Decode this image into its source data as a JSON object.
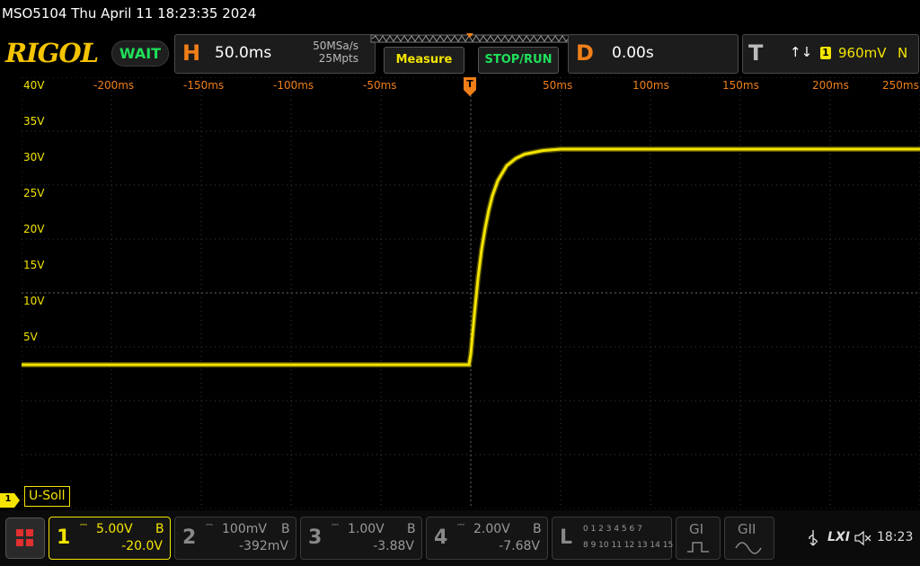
{
  "status": {
    "text": "MSO5104  Thu April 11 18:23:35 2024"
  },
  "header": {
    "logo": "RIGOL",
    "run_state": "WAIT",
    "horizontal": {
      "letter": "H",
      "timebase": "50.0ms",
      "sample_rate": "50MSa/s",
      "memory_depth": "25Mpts"
    },
    "measure_label": "Measure",
    "stop_run_label": "STOP/RUN",
    "delay": {
      "letter": "D",
      "value": "0.00s"
    },
    "trigger": {
      "letter": "T",
      "slope_glyph": "↑↓",
      "source": "1",
      "level": "960mV",
      "mode": "N"
    }
  },
  "channel_label": "U-Soll",
  "ch1_marker": "1",
  "trigger_marker": "T",
  "chart_data": {
    "type": "line",
    "y_ticks": [
      "40V",
      "35V",
      "30V",
      "25V",
      "20V",
      "15V",
      "10V",
      "5V"
    ],
    "x_ticks": [
      "-200ms",
      "-150ms",
      "-100ms",
      "-50ms",
      "50ms",
      "100ms",
      "150ms",
      "200ms",
      "250ms"
    ],
    "xlim": [
      -250,
      250
    ],
    "ylim": [
      -20,
      40
    ],
    "grid": true,
    "series": [
      {
        "name": "U-Soll",
        "x": [
          -250,
          -200,
          -150,
          -100,
          -50,
          -1,
          0,
          2,
          4,
          6,
          8,
          10,
          12,
          15,
          20,
          25,
          30,
          40,
          50,
          75,
          100,
          150,
          200,
          250
        ],
        "y": [
          0,
          0,
          0,
          0,
          0,
          0,
          1.5,
          7,
          12,
          16,
          19,
          21.5,
          23.5,
          25.6,
          27.7,
          28.7,
          29.3,
          29.8,
          30,
          30,
          30,
          30,
          30,
          30
        ]
      }
    ],
    "colors": {
      "ch1": "#f4e400"
    }
  },
  "bottom": {
    "menu_icon": "menu-grid-icon",
    "channels": [
      {
        "num": "1",
        "scale": "5.00V",
        "bw": "B",
        "offset": "-20.0V",
        "color": "#f4e400"
      },
      {
        "num": "2",
        "scale": "100mV",
        "bw": "B",
        "offset": "-392mV",
        "color": "#888888"
      },
      {
        "num": "3",
        "scale": "1.00V",
        "bw": "B",
        "offset": "-3.88V",
        "color": "#888888"
      },
      {
        "num": "4",
        "scale": "2.00V",
        "bw": "B",
        "offset": "-7.68V",
        "color": "#888888"
      }
    ],
    "logic": {
      "letter": "L",
      "row1": "0 1 2 3  4 5 6 7",
      "row2": "8 9 10 11 12 13 14 15"
    },
    "gen1": "GI",
    "gen2": "GII",
    "lxi": "LXI",
    "clock": "18:23"
  }
}
